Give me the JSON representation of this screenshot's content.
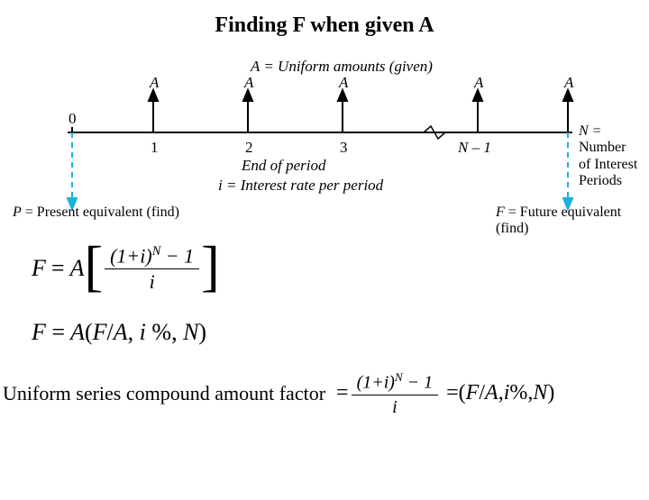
{
  "title": "Finding F when given A",
  "diagram": {
    "top_label": "A = Uniform amounts (given)",
    "arrow_labels": [
      "A",
      "A",
      "A",
      "A",
      "A"
    ],
    "tick_labels": [
      "0",
      "1",
      "2",
      "3",
      "N – 1"
    ],
    "N_text": "N =",
    "N_desc1": "Number",
    "N_desc2": "of Interest",
    "N_desc3": "Periods",
    "end_label": "End of period",
    "i_label": "i = Interest rate per period",
    "P_label": "P = Present equivalent (find)",
    "F_label": "F = Future equivalent (find)"
  },
  "formulas": {
    "F": "F",
    "A": "A",
    "eq": "=",
    "lbracket": "[",
    "rbracket": "]",
    "one_plus_i": "(1+",
    "i": "i",
    "close": ")",
    "N": "N",
    "minus1": " −1",
    "notation": "F = A(F/A, i %, N)",
    "notation_text": "( F/A , i % , N )"
  },
  "chart_data": {
    "type": "diagram",
    "description": "Cash-flow timeline for a uniform series: uniform amount A occurs at the end of each of N periods (periods 1 through N). P is the present equivalent at time 0 and F is the future equivalent at time N. i is the interest rate per period.",
    "timeline_periods": [
      "0",
      "1",
      "2",
      "3",
      "...",
      "N-1",
      "N"
    ],
    "uniform_amount_periods": [
      1,
      2,
      3,
      "…",
      "N-1",
      "N"
    ],
    "P_at": 0,
    "F_at": "N"
  },
  "bottom": {
    "label": "Uniform series compound amount factor"
  }
}
